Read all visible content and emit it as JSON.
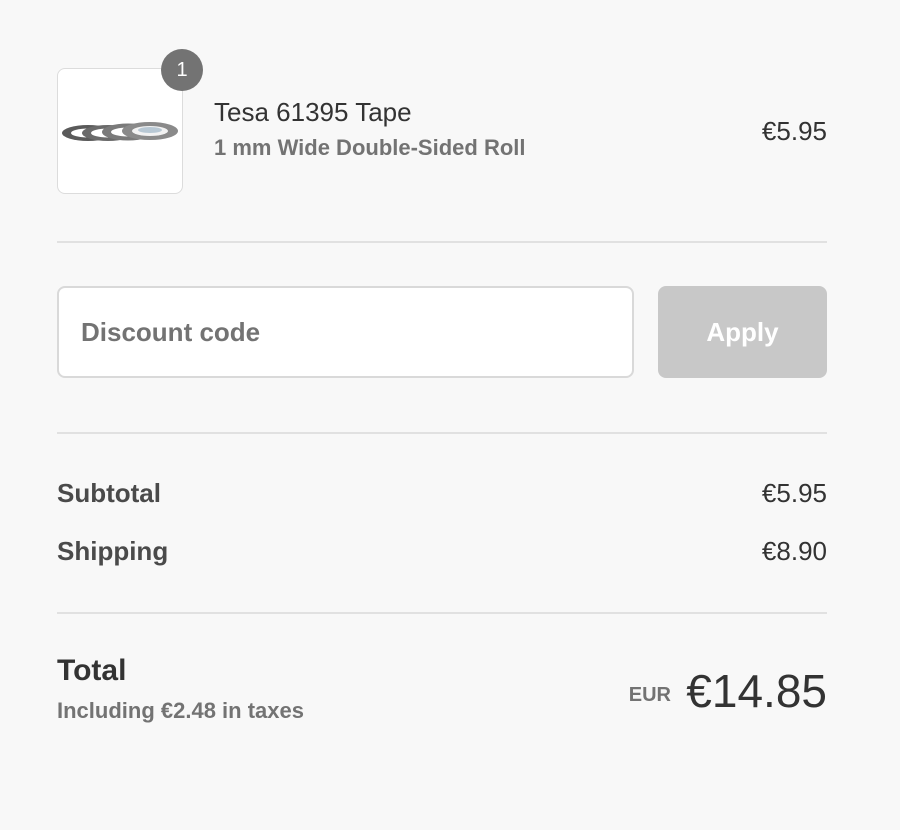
{
  "product": {
    "image_alt": "Tesa tape rolls",
    "quantity": "1",
    "name": "Tesa 61395 Tape",
    "variant": "1 mm Wide Double-Sided Roll",
    "price": "€5.95"
  },
  "discount": {
    "placeholder": "Discount code",
    "value": "",
    "apply_label": "Apply"
  },
  "costs": {
    "subtotal_label": "Subtotal",
    "subtotal_value": "€5.95",
    "shipping_label": "Shipping",
    "shipping_value": "€8.90"
  },
  "total": {
    "label": "Total",
    "taxes_note": "Including €2.48 in taxes",
    "currency": "EUR",
    "amount": "€14.85"
  },
  "colors": {
    "background": "#f8f8f8",
    "badge": "#737373",
    "button_disabled": "#c8c8c8",
    "text": "#333333",
    "muted_text": "#737373"
  }
}
